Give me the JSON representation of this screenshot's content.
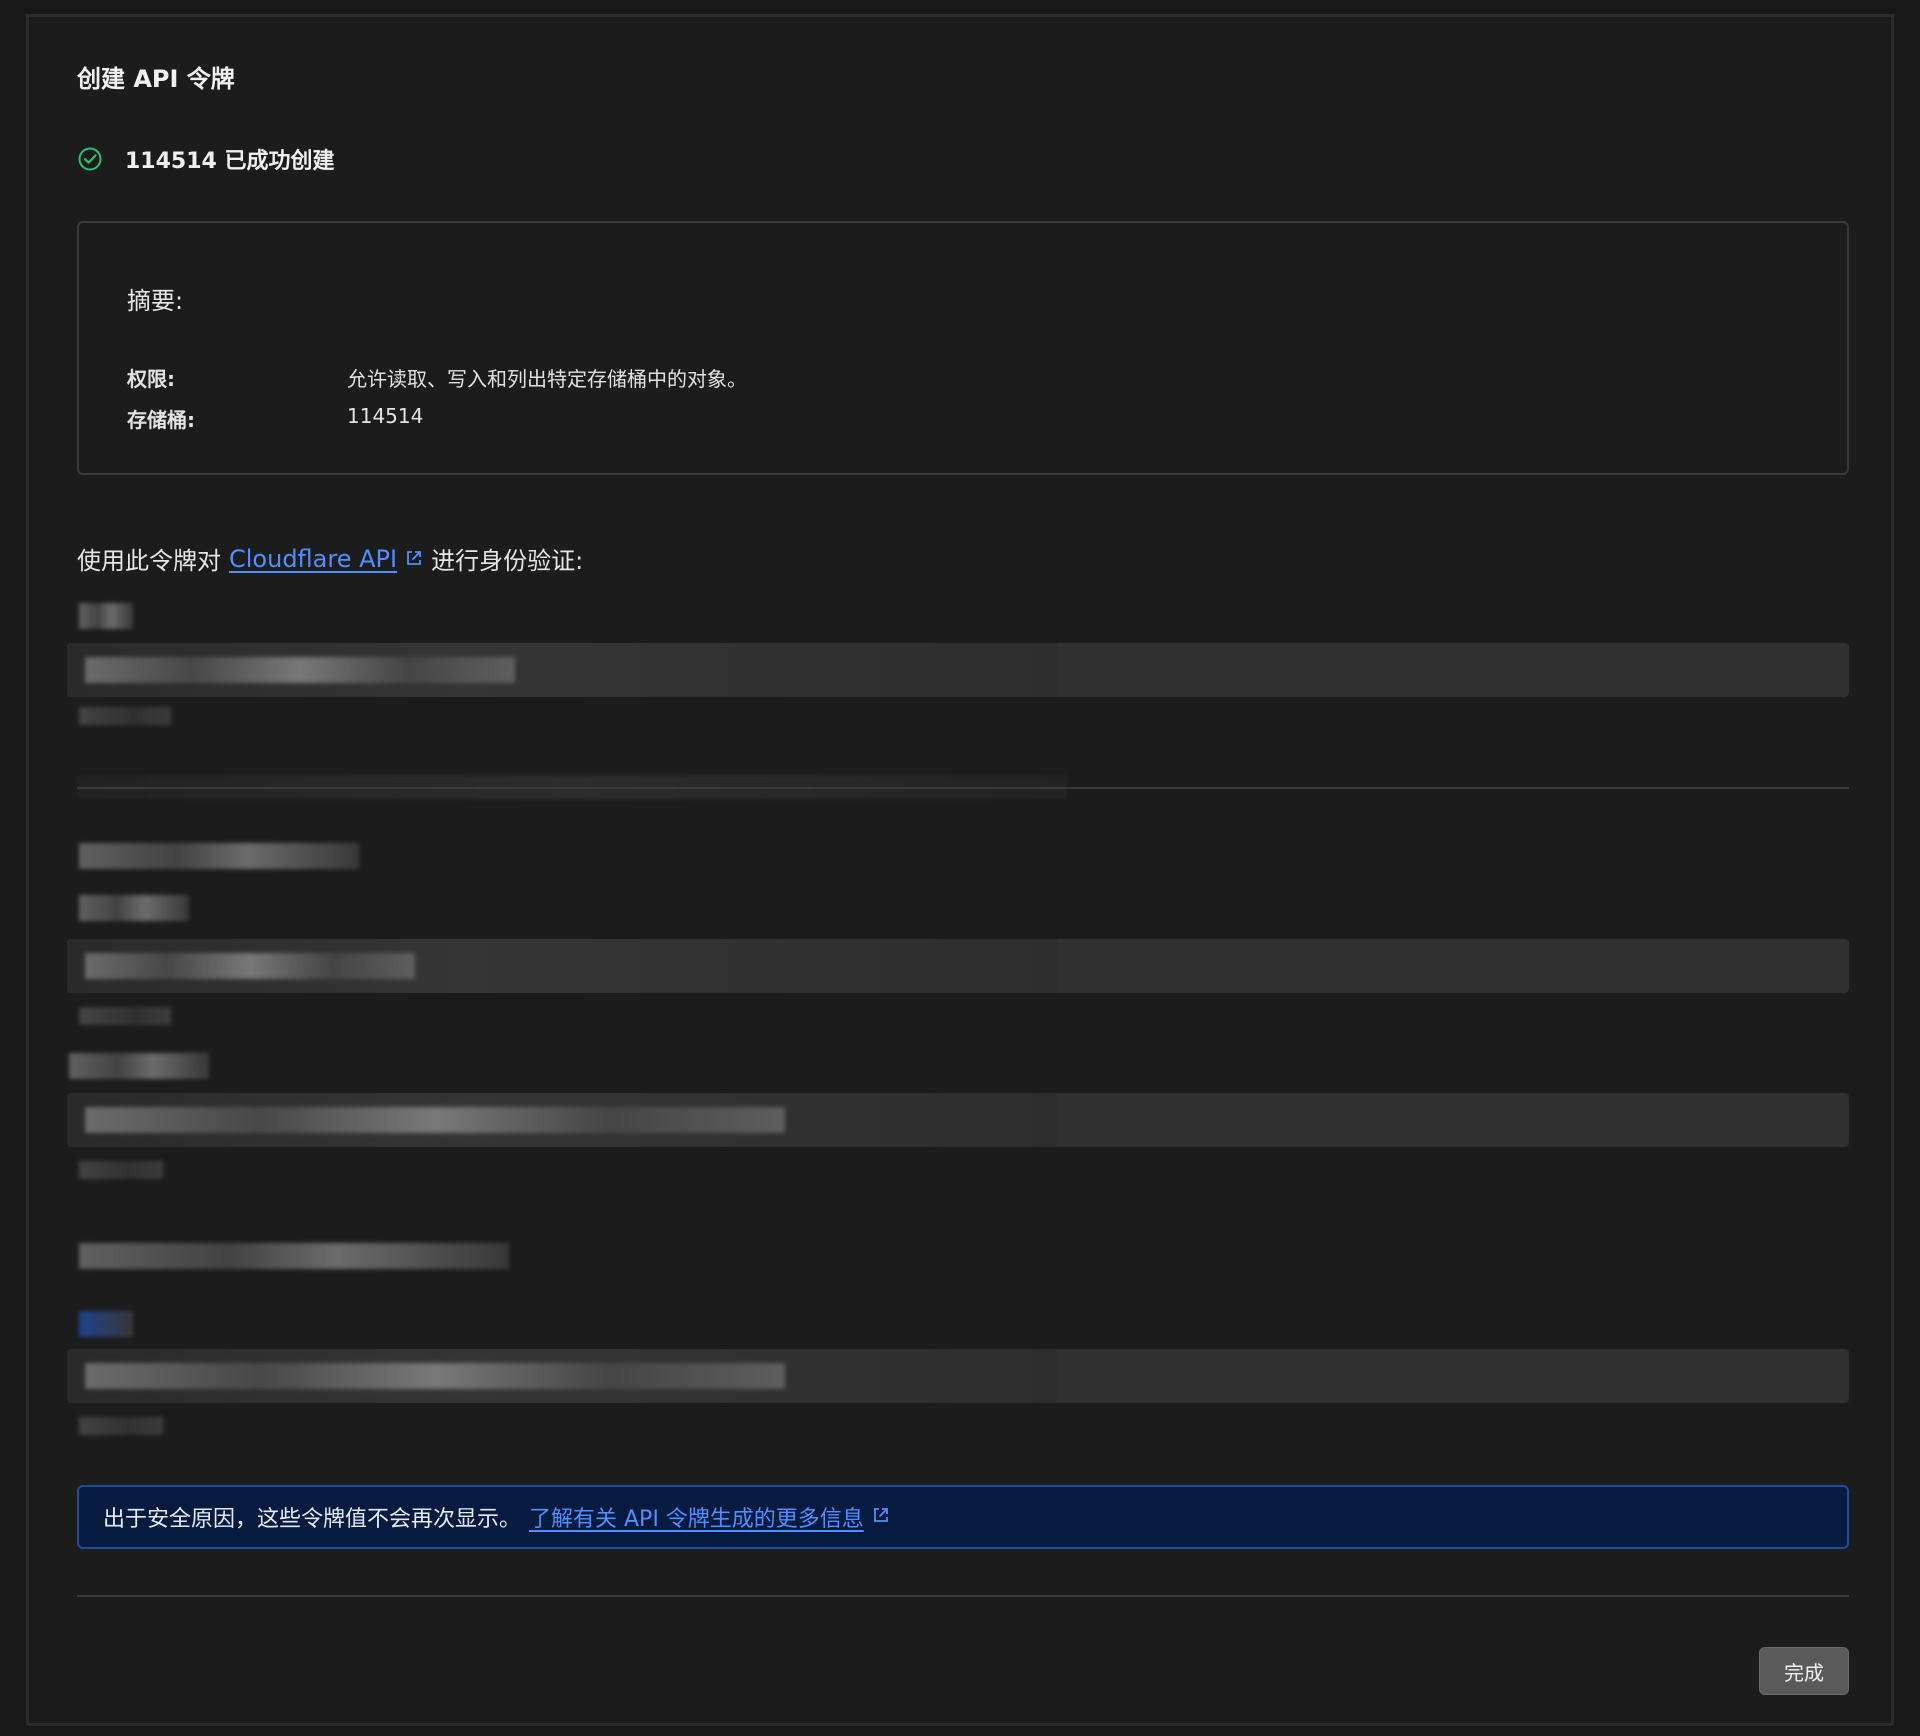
{
  "header": {
    "title": "创建 API 令牌"
  },
  "status": {
    "icon": "check-circle-icon",
    "text": "114514 已成功创建",
    "color": "#2fbf71"
  },
  "summary": {
    "title": "摘要:",
    "rows": [
      {
        "key": "权限:",
        "value": "允许读取、写入和列出特定存储桶中的对象。"
      },
      {
        "key": "存储桶:",
        "value": "114514"
      }
    ]
  },
  "auth": {
    "prefix": "使用此令牌对",
    "link": "Cloudflare API",
    "suffix": "进行身份验证:",
    "link_icon": "external-link-icon",
    "link_color": "#4f8fff"
  },
  "notice": {
    "text": "出于安全原因，这些令牌值不会再次显示。",
    "link": "了解有关 API 令牌生成的更多信息",
    "link_icon": "external-link-icon",
    "bg_color": "#071a3f",
    "border_color": "#1b4e9a"
  },
  "footer": {
    "done_label": "完成"
  }
}
